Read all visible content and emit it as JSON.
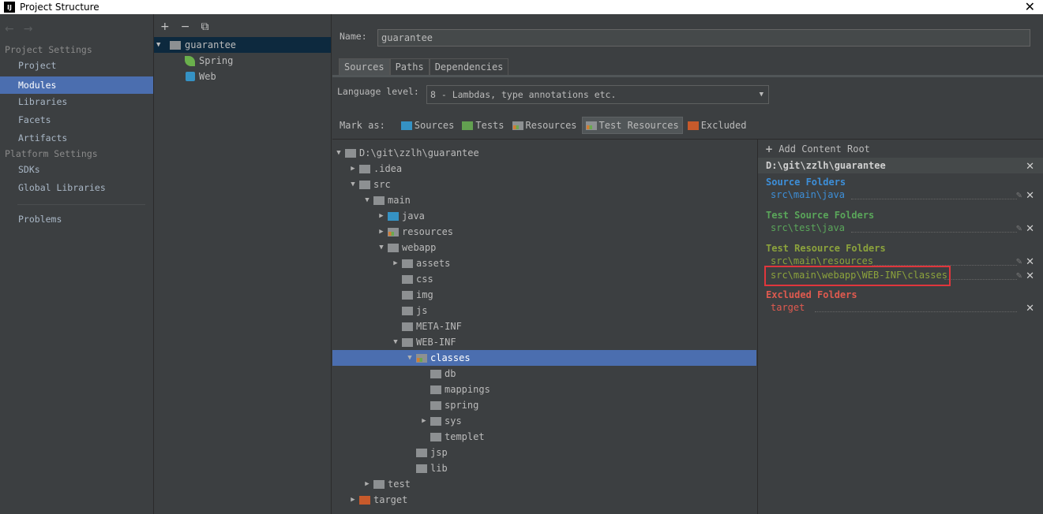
{
  "window": {
    "title": "Project Structure",
    "app_icon_text": "IJ",
    "close_glyph": "✕"
  },
  "sidebar": {
    "nav_back": "←",
    "nav_forward": "→",
    "project_settings_title": "Project Settings",
    "project_items": [
      "Project",
      "Modules",
      "Libraries",
      "Facets",
      "Artifacts"
    ],
    "selected": "Modules",
    "platform_settings_title": "Platform Settings",
    "platform_items": [
      "SDKs",
      "Global Libraries"
    ],
    "problems_label": "Problems"
  },
  "modules": {
    "toolbar": {
      "add": "+",
      "remove": "−",
      "copy": "⧉"
    },
    "items": [
      {
        "label": "guarantee",
        "expanded": true,
        "icon": "module-folder-icon"
      },
      {
        "label": "Spring",
        "icon": "spring-leaf-icon"
      },
      {
        "label": "Web",
        "icon": "web-facet-icon"
      }
    ]
  },
  "detail": {
    "name_label": "Name:",
    "name_value": "guarantee",
    "tabs": [
      "Sources",
      "Paths",
      "Dependencies"
    ],
    "active_tab": "Sources",
    "language_level_label": "Language level:",
    "language_level_value": "8 - Lambdas, type annotations etc.",
    "mark_as_label": "Mark as:",
    "mark_buttons": [
      {
        "label": "Sources",
        "color": "#3592c4"
      },
      {
        "label": "Tests",
        "color": "#62a050"
      },
      {
        "label": "Resources",
        "color": "#8d9092"
      },
      {
        "label": "Test Resources",
        "color": "#8d9092",
        "active": true
      },
      {
        "label": "Excluded",
        "color": "#c75a2b"
      }
    ]
  },
  "tree": {
    "rows": [
      {
        "label": "D:\\git\\zzlh\\guarantee",
        "level": 0,
        "arrow": "down",
        "folder": "gray"
      },
      {
        "label": ".idea",
        "level": 1,
        "arrow": "right",
        "folder": "gray"
      },
      {
        "label": "src",
        "level": 1,
        "arrow": "down",
        "folder": "gray"
      },
      {
        "label": "main",
        "level": 2,
        "arrow": "down",
        "folder": "gray"
      },
      {
        "label": "java",
        "level": 3,
        "arrow": "right",
        "folder": "blue"
      },
      {
        "label": "resources",
        "level": 3,
        "arrow": "right",
        "folder": "res"
      },
      {
        "label": "webapp",
        "level": 3,
        "arrow": "down",
        "folder": "gray"
      },
      {
        "label": "assets",
        "level": 4,
        "arrow": "right",
        "folder": "gray"
      },
      {
        "label": "css",
        "level": 4,
        "arrow": "none",
        "folder": "gray"
      },
      {
        "label": "img",
        "level": 4,
        "arrow": "none",
        "folder": "gray"
      },
      {
        "label": "js",
        "level": 4,
        "arrow": "none",
        "folder": "gray"
      },
      {
        "label": "META-INF",
        "level": 4,
        "arrow": "none",
        "folder": "gray"
      },
      {
        "label": "WEB-INF",
        "level": 4,
        "arrow": "down",
        "folder": "gray"
      },
      {
        "label": "classes",
        "level": 5,
        "arrow": "down",
        "folder": "res",
        "selected": true
      },
      {
        "label": "db",
        "level": 6,
        "arrow": "none",
        "folder": "gray"
      },
      {
        "label": "mappings",
        "level": 6,
        "arrow": "none",
        "folder": "gray"
      },
      {
        "label": "spring",
        "level": 6,
        "arrow": "none",
        "folder": "gray"
      },
      {
        "label": "sys",
        "level": 6,
        "arrow": "right",
        "folder": "gray"
      },
      {
        "label": "templet",
        "level": 6,
        "arrow": "none",
        "folder": "gray"
      },
      {
        "label": "jsp",
        "level": 5,
        "arrow": "none",
        "folder": "gray"
      },
      {
        "label": "lib",
        "level": 5,
        "arrow": "none",
        "folder": "gray"
      },
      {
        "label": "test",
        "level": 2,
        "arrow": "right",
        "folder": "gray"
      },
      {
        "label": "target",
        "level": 1,
        "arrow": "right",
        "folder": "orange"
      }
    ]
  },
  "roots": {
    "add_content_root": "Add Content Root",
    "add_glyph": "+",
    "root_path": "D:\\git\\zzlh\\guarantee",
    "source_folders_title": "Source Folders",
    "source_folders": [
      "src\\main\\java"
    ],
    "test_source_folders_title": "Test Source Folders",
    "test_source_folders": [
      "src\\test\\java"
    ],
    "test_resource_folders_title": "Test Resource Folders",
    "test_resource_folders": [
      "src\\main\\resources",
      "src\\main\\webapp\\WEB-INF\\classes"
    ],
    "excluded_folders_title": "Excluded Folders",
    "excluded_folders": [
      "target"
    ],
    "colors": {
      "source": "#3d8fd9",
      "test": "#5aa65a",
      "test_resource": "#8ca33c",
      "excluded": "#e05a4f"
    }
  }
}
